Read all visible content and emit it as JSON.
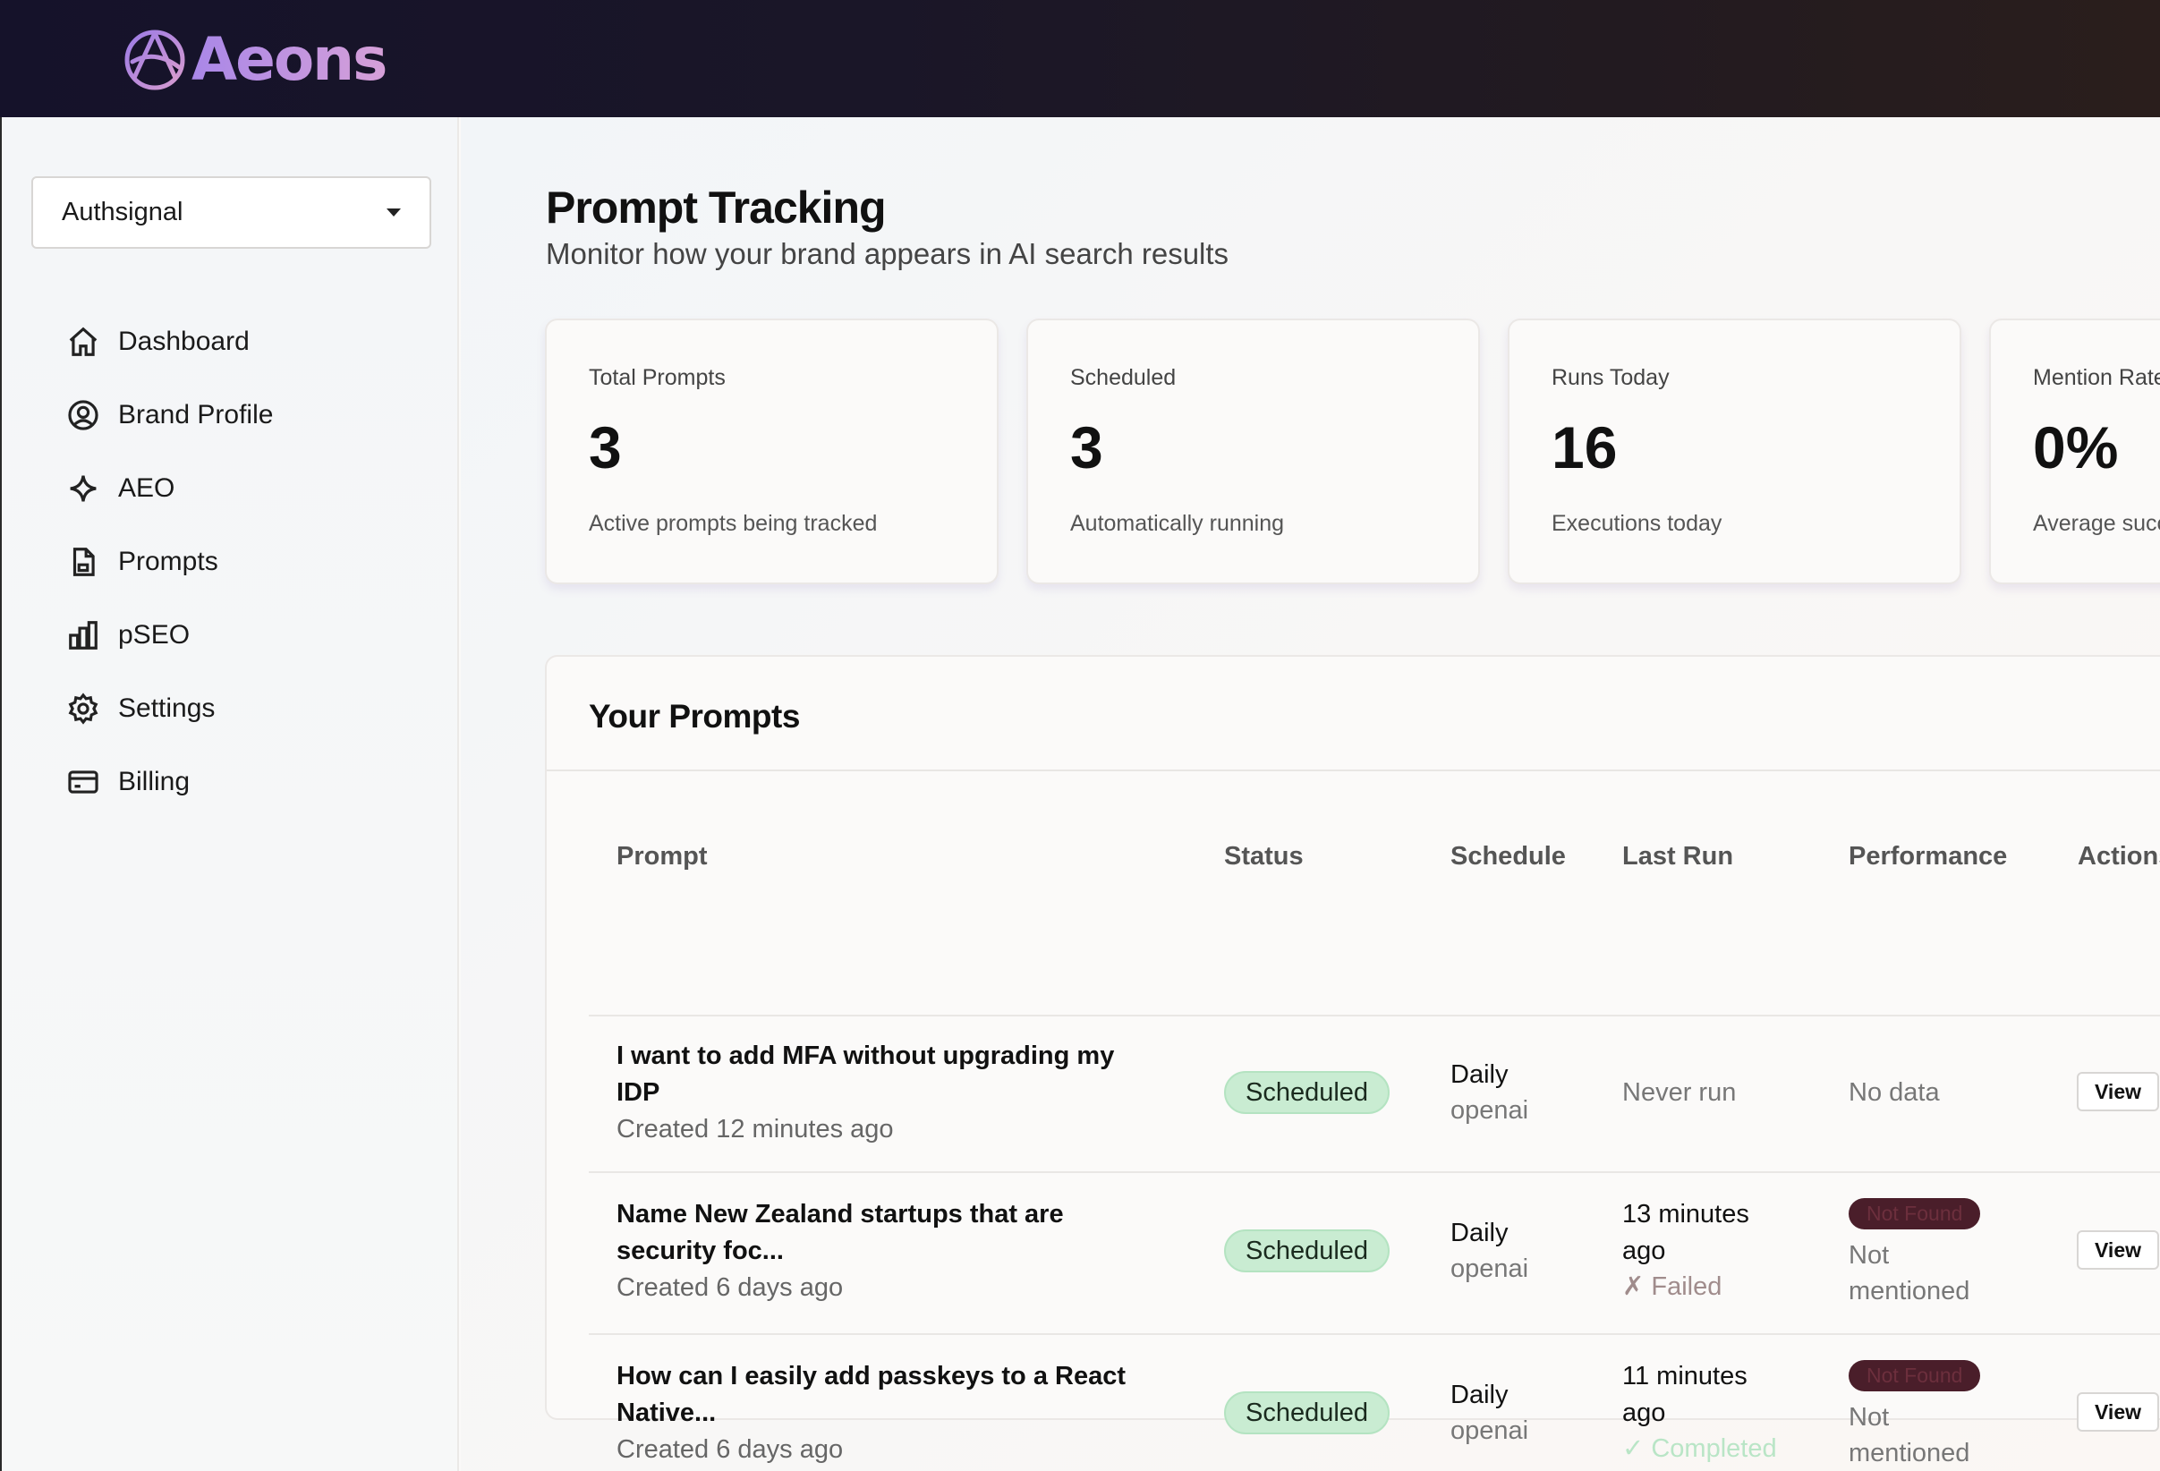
{
  "app": {
    "name": "Aeons"
  },
  "sidebar": {
    "org_selected": "Authsignal",
    "items": [
      {
        "label": "Dashboard",
        "icon": "home-icon"
      },
      {
        "label": "Brand Profile",
        "icon": "user-circle-icon"
      },
      {
        "label": "AEO",
        "icon": "sparkle-icon"
      },
      {
        "label": "Prompts",
        "icon": "document-icon"
      },
      {
        "label": "pSEO",
        "icon": "bar-chart-icon"
      },
      {
        "label": "Settings",
        "icon": "gear-icon"
      },
      {
        "label": "Billing",
        "icon": "credit-card-icon"
      }
    ]
  },
  "page": {
    "title": "Prompt Tracking",
    "subtitle": "Monitor how your brand appears in AI search results"
  },
  "stats": [
    {
      "label": "Total Prompts",
      "value": "3",
      "desc": "Active prompts being tracked"
    },
    {
      "label": "Scheduled",
      "value": "3",
      "desc": "Automatically running"
    },
    {
      "label": "Runs Today",
      "value": "16",
      "desc": "Executions today"
    },
    {
      "label": "Mention Rate",
      "value": "0%",
      "desc": "Average success rate"
    }
  ],
  "prompts_panel": {
    "title": "Your Prompts",
    "columns": [
      "Prompt",
      "Status",
      "Schedule",
      "Last Run",
      "Performance",
      "Actions"
    ],
    "rows": [
      {
        "title_line1": "I want to add MFA without upgrading my",
        "title_line2": "IDP",
        "created": "Created 12 minutes ago",
        "status": "Scheduled",
        "schedule": "Daily",
        "provider": "openai",
        "last_run_line1": "Never run",
        "last_run_line2": "",
        "last_run_result": "",
        "performance_badge": "",
        "performance_line1": "No data",
        "performance_line2": "",
        "action": "View"
      },
      {
        "title_line1": "Name New Zealand startups that are",
        "title_line2": "security foc...",
        "created": "Created 6 days ago",
        "status": "Scheduled",
        "schedule": "Daily",
        "provider": "openai",
        "last_run_line1": "13 minutes",
        "last_run_line2": "ago",
        "last_run_result": "✗ Failed",
        "performance_badge": "Not Found",
        "performance_line1": "Not",
        "performance_line2": "mentioned",
        "action": "View"
      },
      {
        "title_line1": "How can I easily add passkeys to a React",
        "title_line2": "Native...",
        "created": "Created 6 days ago",
        "status": "Scheduled",
        "schedule": "Daily",
        "provider": "openai",
        "last_run_line1": "11 minutes",
        "last_run_line2": "ago",
        "last_run_result": "✓ Completed",
        "performance_badge": "Not Found",
        "performance_line1": "Not",
        "performance_line2": "mentioned",
        "action": "View"
      }
    ]
  }
}
